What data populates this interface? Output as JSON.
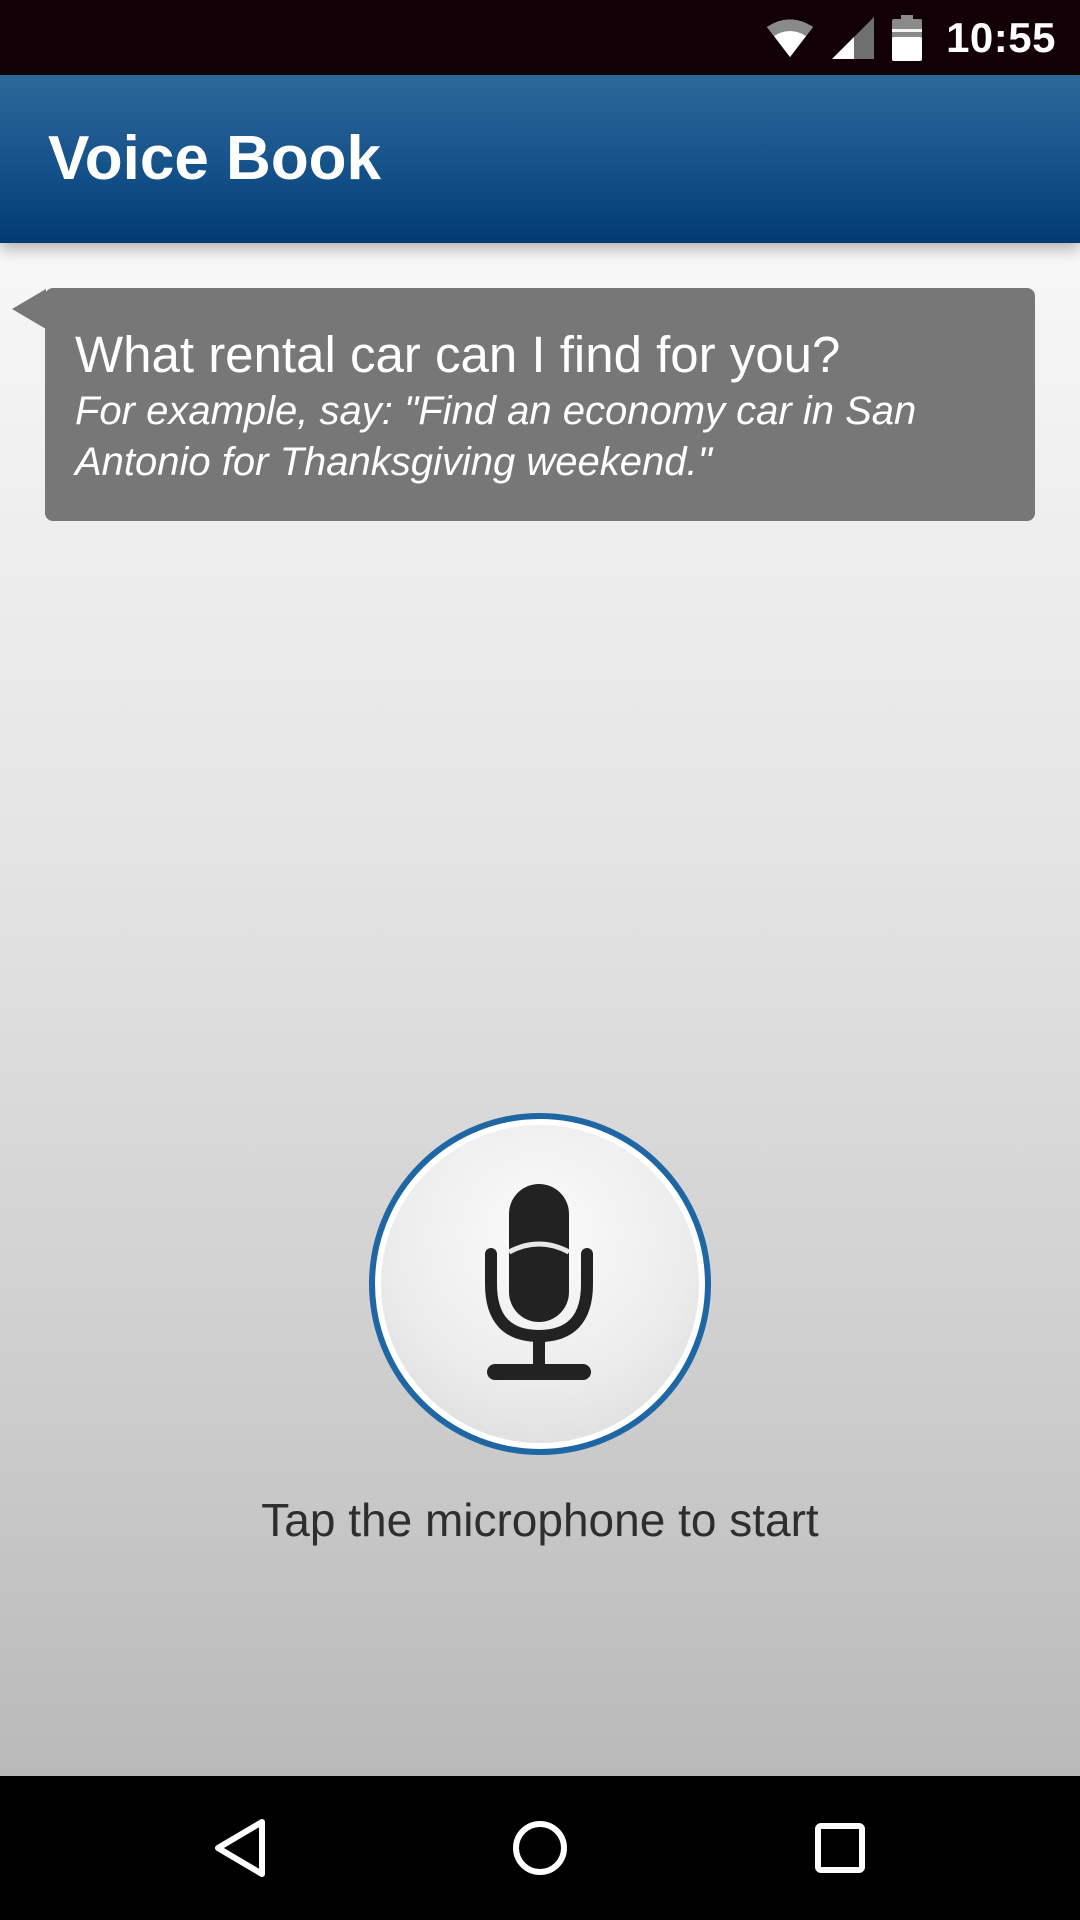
{
  "status_bar": {
    "time": "10:55",
    "icons": [
      "wifi-icon",
      "cell-signal-icon",
      "battery-icon"
    ]
  },
  "app_bar": {
    "title": "Voice Book"
  },
  "prompt_bubble": {
    "question": "What rental car can I find for you?",
    "example_line1": "For example, say: \"Find an economy car in San",
    "example_line2": "Antonio for Thanksgiving weekend.\""
  },
  "microphone": {
    "icon": "microphone-icon",
    "hint": "Tap the microphone to start"
  },
  "nav_bar": {
    "icons": [
      "back-icon",
      "home-icon",
      "recents-icon"
    ]
  },
  "colors": {
    "status_bar_bg": "#120006",
    "app_bar_top": "#2d6899",
    "app_bar_bottom": "#023b72",
    "bubble_bg": "#777777",
    "mic_ring": "#1f66a4",
    "mic_glyph": "#222222",
    "hint_text": "#2e2e2e"
  }
}
